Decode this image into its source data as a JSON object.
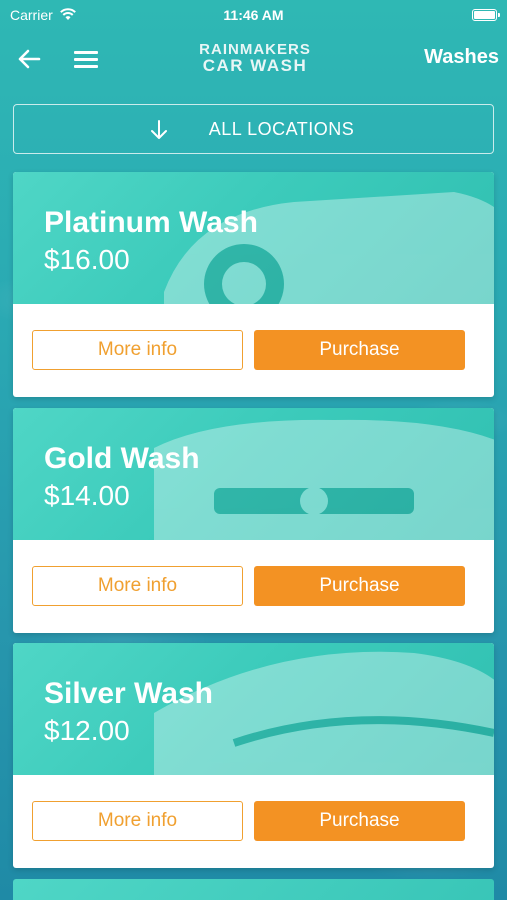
{
  "status_bar": {
    "carrier": "Carrier",
    "time": "11:46 AM"
  },
  "nav": {
    "logo_line1": "RAINMAKERS",
    "logo_line2": "CAR WASH",
    "title": "Washes"
  },
  "location_filter": {
    "label": "ALL LOCATIONS"
  },
  "washes": [
    {
      "name": "Platinum Wash",
      "price": "$16.00",
      "more_info_label": "More info",
      "purchase_label": "Purchase"
    },
    {
      "name": "Gold Wash",
      "price": "$14.00",
      "more_info_label": "More info",
      "purchase_label": "Purchase"
    },
    {
      "name": "Silver Wash",
      "price": "$12.00",
      "more_info_label": "More info",
      "purchase_label": "Purchase"
    }
  ],
  "colors": {
    "accent": "#f39223",
    "teal": "#3ccbbb",
    "background": "#2aa9b3"
  },
  "icons": [
    "wifi-icon",
    "battery-icon",
    "back-arrow-icon",
    "hamburger-menu-icon",
    "down-arrow-icon",
    "car-image"
  ]
}
